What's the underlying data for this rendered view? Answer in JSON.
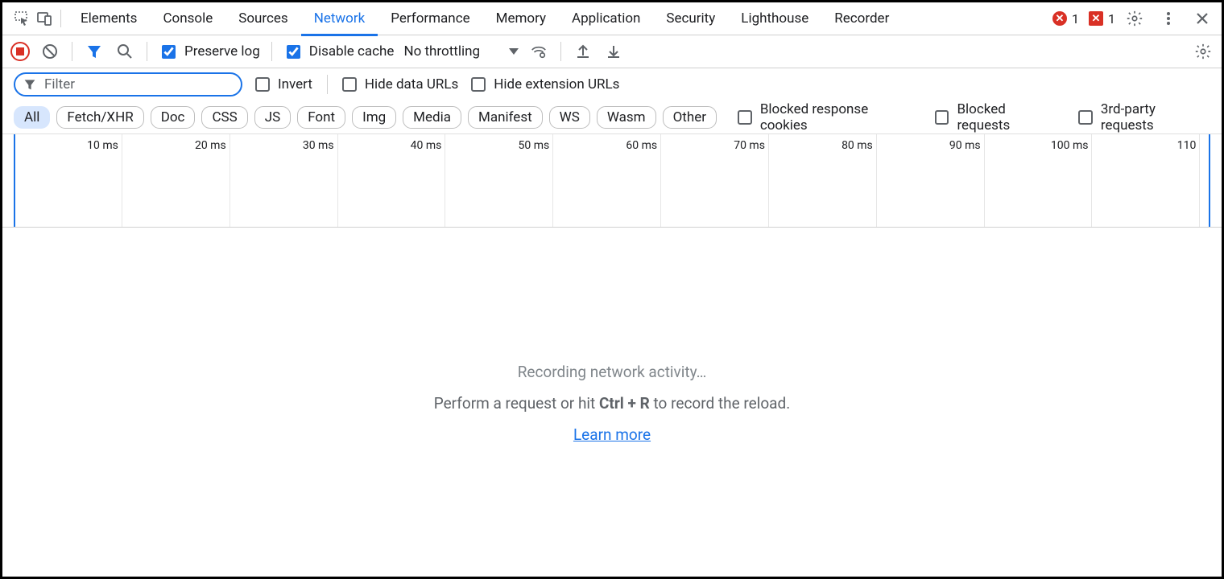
{
  "tabs": {
    "items": [
      "Elements",
      "Console",
      "Sources",
      "Network",
      "Performance",
      "Memory",
      "Application",
      "Security",
      "Lighthouse",
      "Recorder"
    ],
    "activeIndex": 3
  },
  "topbar": {
    "error_count": "1",
    "issue_count": "1"
  },
  "toolbar": {
    "preserve_log": "Preserve log",
    "disable_cache": "Disable cache",
    "throttling": "No throttling"
  },
  "filter": {
    "placeholder": "Filter",
    "invert": "Invert",
    "hide_data_urls": "Hide data URLs",
    "hide_extension_urls": "Hide extension URLs"
  },
  "pills": {
    "items": [
      "All",
      "Fetch/XHR",
      "Doc",
      "CSS",
      "JS",
      "Font",
      "Img",
      "Media",
      "Manifest",
      "WS",
      "Wasm",
      "Other"
    ],
    "activeIndex": 0,
    "blocked_response_cookies": "Blocked response cookies",
    "blocked_requests": "Blocked requests",
    "third_party_requests": "3rd-party requests"
  },
  "timeline": {
    "ticks": [
      "10 ms",
      "20 ms",
      "30 ms",
      "40 ms",
      "50 ms",
      "60 ms",
      "70 ms",
      "80 ms",
      "90 ms",
      "100 ms",
      "110"
    ]
  },
  "empty": {
    "title": "Recording network activity…",
    "hint_prefix": "Perform a request or hit ",
    "hint_shortcut": "Ctrl + R",
    "hint_suffix": " to record the reload.",
    "learn_more": "Learn more"
  }
}
